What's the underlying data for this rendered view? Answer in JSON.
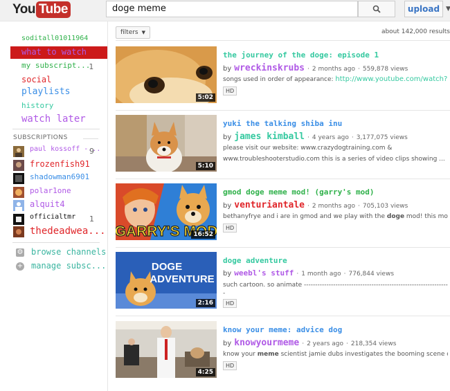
{
  "header": {
    "logo_you": "You",
    "logo_tube": "Tube",
    "search_value": "doge meme",
    "upload_label": "upload"
  },
  "sidebar": {
    "username": "soditall01011964",
    "nav": [
      {
        "label": "what to watch",
        "count": ""
      },
      {
        "label": "my subscript...",
        "count": "1"
      },
      {
        "label": "social",
        "count": ""
      },
      {
        "label": "playlists",
        "count": ""
      },
      {
        "label": "history",
        "count": ""
      },
      {
        "label": "watch later",
        "count": ""
      }
    ],
    "subscriptions_title": "SUBSCRIPTIONS",
    "subscriptions": [
      {
        "label": "paul kossoff -...",
        "count": "9"
      },
      {
        "label": "frozenfish91",
        "count": ""
      },
      {
        "label": "shadowman6901",
        "count": ""
      },
      {
        "label": "polar1one",
        "count": ""
      },
      {
        "label": "alquit4",
        "count": ""
      },
      {
        "label": "officialtmr",
        "count": "1"
      },
      {
        "label": "thedeadwea...",
        "count": ""
      }
    ],
    "footer": [
      {
        "label": "browse channels",
        "icon": "gear-icon"
      },
      {
        "label": "manage subsc...",
        "icon": "plus-icon"
      }
    ]
  },
  "toolbar": {
    "filters_label": "filters",
    "results_count": "about 142,000 results"
  },
  "results": [
    {
      "title": "the journey of the doge: episode 1",
      "by": "by",
      "channel": "wreckinskrubs",
      "age": "2 months ago",
      "views": "559,878 views",
      "desc_text": "songs used in order of appearance: ",
      "desc_link": "http://www.youtube.com/watch?...",
      "duration": "5:02",
      "hd": "HD"
    },
    {
      "title": "yuki the talking shiba inu",
      "by": "by",
      "channel": "james kimball",
      "age": "4 years ago",
      "views": "3,177,075 views",
      "desc_line1": "please visit our website: www.crazydogtraining.com &",
      "desc_line2": "www.troubleshooterstudio.com this is a series of video clips showing ...",
      "duration": "5:10"
    },
    {
      "title": "gmod doge meme mod! (garry's mod)",
      "by": "by",
      "channel": "venturiantale",
      "age": "2 months ago",
      "views": "705,103 views",
      "desc_pre": "bethanyfrye and i are in gmod and we play with the ",
      "desc_bold": "doge",
      "desc_post": " mod! this mod i...",
      "duration": "16:52",
      "hd": "HD",
      "thumb_text": "GARRY'S MOD"
    },
    {
      "title": "doge adventure",
      "by": "by",
      "channel": "weebl's stuff",
      "age": "1 month ago",
      "views": "776,844 views",
      "desc_line1": "such cartoon. so animate ----------------------------------------------------------------",
      "desc_line2": "-",
      "duration": "2:16",
      "hd": "HD",
      "thumb_text_1": "DOGE",
      "thumb_text_2": "ADVENTURE"
    },
    {
      "title": "know your meme: advice dog",
      "by": "by",
      "channel": "knowyourmeme",
      "age": "2 years ago",
      "views": "218,354 views",
      "desc_pre": "know your ",
      "desc_bold": "meme",
      "desc_post": " scientist jamie dubs investigates the booming scene of a...",
      "duration": "4:25",
      "hd": "HD"
    }
  ],
  "colors": {
    "accent_red": "#cc1a1a",
    "teal": "#35c9a0",
    "green": "#2fb14a",
    "purple": "#b05ae6",
    "red_text": "#e0262a",
    "blue": "#3a8ee6"
  }
}
